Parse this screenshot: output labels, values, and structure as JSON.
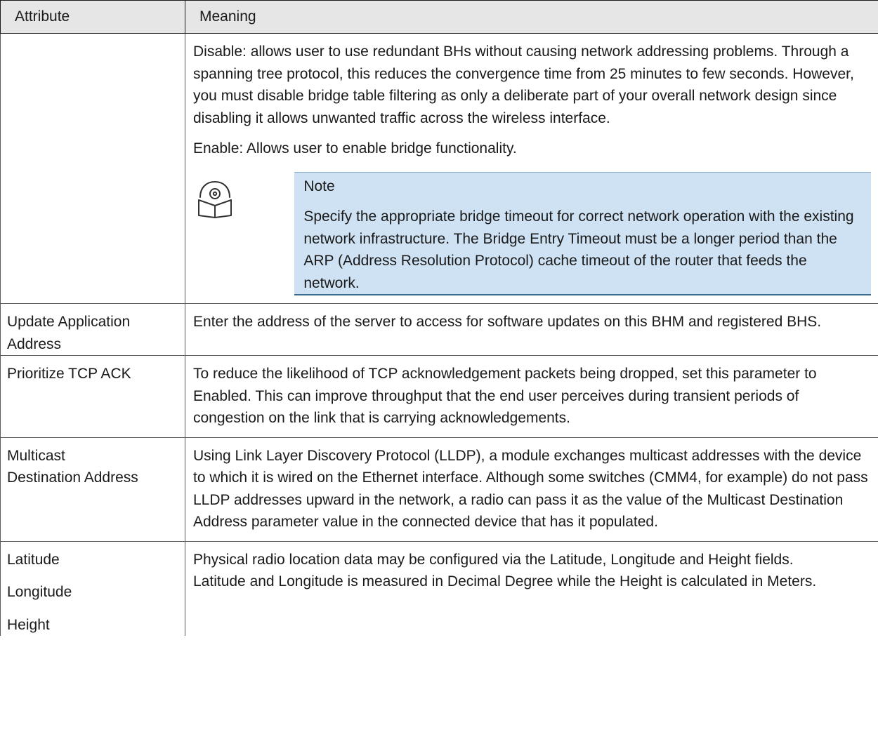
{
  "header": {
    "attribute": "Attribute",
    "meaning": "Meaning"
  },
  "rows": {
    "bridge": {
      "attributes": [],
      "para1": "Disable: allows user to use redundant BHs without causing network addressing problems. Through a spanning tree protocol, this reduces the convergence time from 25 minutes to few seconds. However, you must disable bridge table filtering as only a deliberate part of your overall network design since disabling it allows unwanted traffic across the wireless interface.",
      "para2": "Enable: Allows user to enable bridge functionality.",
      "note": {
        "icon": "book-reader-icon",
        "title": "Note",
        "text": "Specify the appropriate bridge timeout for correct network operation with the existing network infrastructure. The Bridge Entry Timeout must be a longer period than the ARP (Address Resolution Protocol) cache timeout of the router that feeds the network."
      }
    },
    "update": {
      "attribute": "Update Application Address",
      "meaning": "Enter the address of the server to access for software updates on this BHM and registered BHS."
    },
    "tcp": {
      "attribute": "Prioritize TCP ACK",
      "meaning": "To reduce the likelihood of TCP acknowledgement packets being dropped, set this parameter to Enabled. This can improve throughput that the end user perceives during transient periods of congestion on the link that is carrying acknowledgements."
    },
    "multicast": {
      "attribute": "Multicast Destination Address",
      "meaning": "Using Link Layer Discovery Protocol (LLDP), a module exchanges multicast addresses with the device to which it is wired on the Ethernet interface. Although some switches (CMM4, for example) do not pass LLDP addresses upward in the network, a radio can pass it as the value of the Multicast Destination Address parameter value in the connected device that has it populated."
    },
    "location": {
      "attr1": "Latitude",
      "attr2": "Longitude",
      "attr3": "Height",
      "line1": "Physical radio location data may be configured via the Latitude, Longitude and Height fields.",
      "line2": "Latitude and Longitude is measured in Decimal Degree while the Height is calculated in Meters."
    }
  }
}
